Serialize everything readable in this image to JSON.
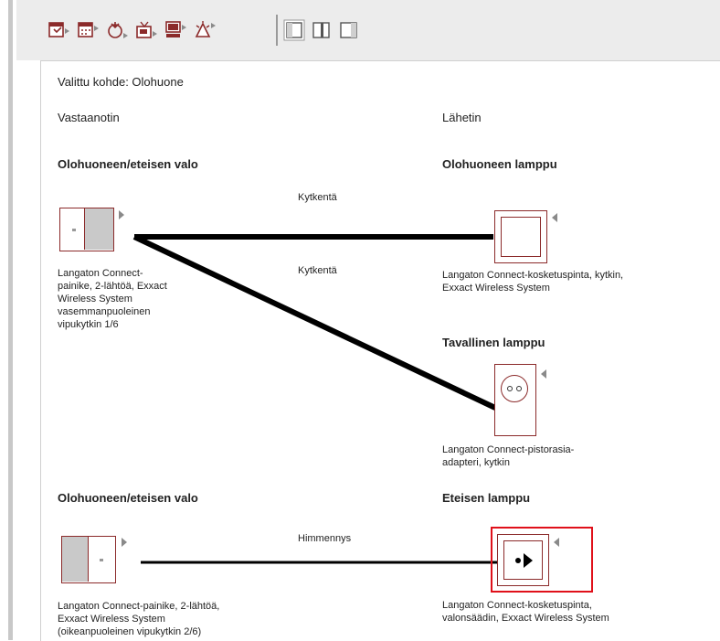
{
  "figure_id": "F121656",
  "toolbar": {
    "icons": [
      "schedule-icon",
      "calendar-icon",
      "scene-icon",
      "tv-icon",
      "computer-icon",
      "alarm-icon"
    ],
    "views": [
      "view-left-icon",
      "view-split-icon",
      "view-right-icon"
    ]
  },
  "selected_target": "Valittu kohde: Olohuone",
  "column_receiver": "Vastaanotin",
  "column_transmitter": "Lähetin",
  "group1": {
    "receiver_title": "Olohuoneen/eteisen valo",
    "receiver_desc": "Langaton Connect-\npainike, 2-lähtöä, Exxact\nWireless System\nvasemmanpuoleinen\nvipukytkin 1/6",
    "links": [
      {
        "label": "Kytkentä"
      },
      {
        "label": "Kytkentä"
      }
    ],
    "transmitters": [
      {
        "title": "Olohuoneen lamppu",
        "desc": "Langaton Connect-kosketuspinta, kytkin,\nExxact Wireless System"
      },
      {
        "title": "Tavallinen lamppu",
        "desc": "Langaton Connect-pistorasia-\nadapteri, kytkin"
      }
    ]
  },
  "group2": {
    "receiver_title": "Olohuoneen/eteisen valo",
    "receiver_desc": "Langaton Connect-painike, 2-lähtöä,\nExxact Wireless System\n(oikeanpuoleinen vipukytkin 2/6)",
    "link_label": "Himmennys",
    "transmitter_title": "Eteisen lamppu",
    "transmitter_desc": "Langaton Connect-kosketuspinta,\nvalonsäädin, Exxact Wireless System"
  },
  "colors": {
    "device_frame": "#8b2a2a",
    "highlight": "#e0101a",
    "toggle_fill": "#c9c9c9"
  }
}
